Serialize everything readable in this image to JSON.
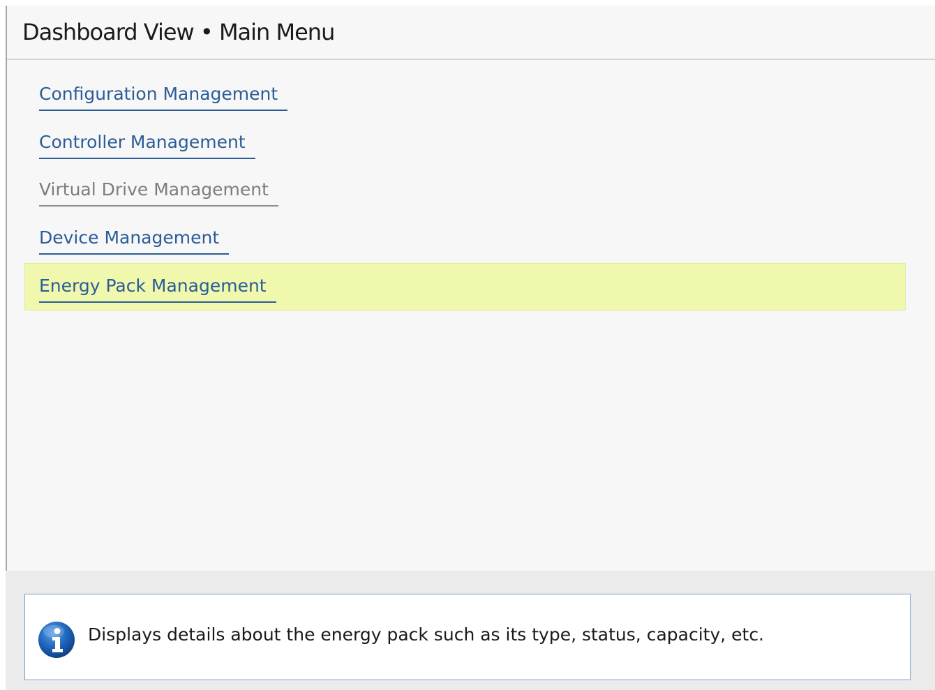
{
  "header": {
    "title": "Dashboard View • Main Menu"
  },
  "menu": {
    "items": [
      {
        "label": "Configuration Management",
        "state": "enabled"
      },
      {
        "label": "Controller Management",
        "state": "enabled"
      },
      {
        "label": "Virtual Drive Management",
        "state": "disabled"
      },
      {
        "label": "Device Management",
        "state": "enabled"
      },
      {
        "label": "Energy Pack Management",
        "state": "selected"
      }
    ]
  },
  "help": {
    "icon": "info-icon",
    "text": "Displays details about the energy pack such as its type, status, capacity, etc."
  },
  "colors": {
    "link": "#2b5c98",
    "disabled": "#7d7d7d",
    "selected_highlight": "#eff8ac",
    "help_border": "#7a9cc6"
  }
}
